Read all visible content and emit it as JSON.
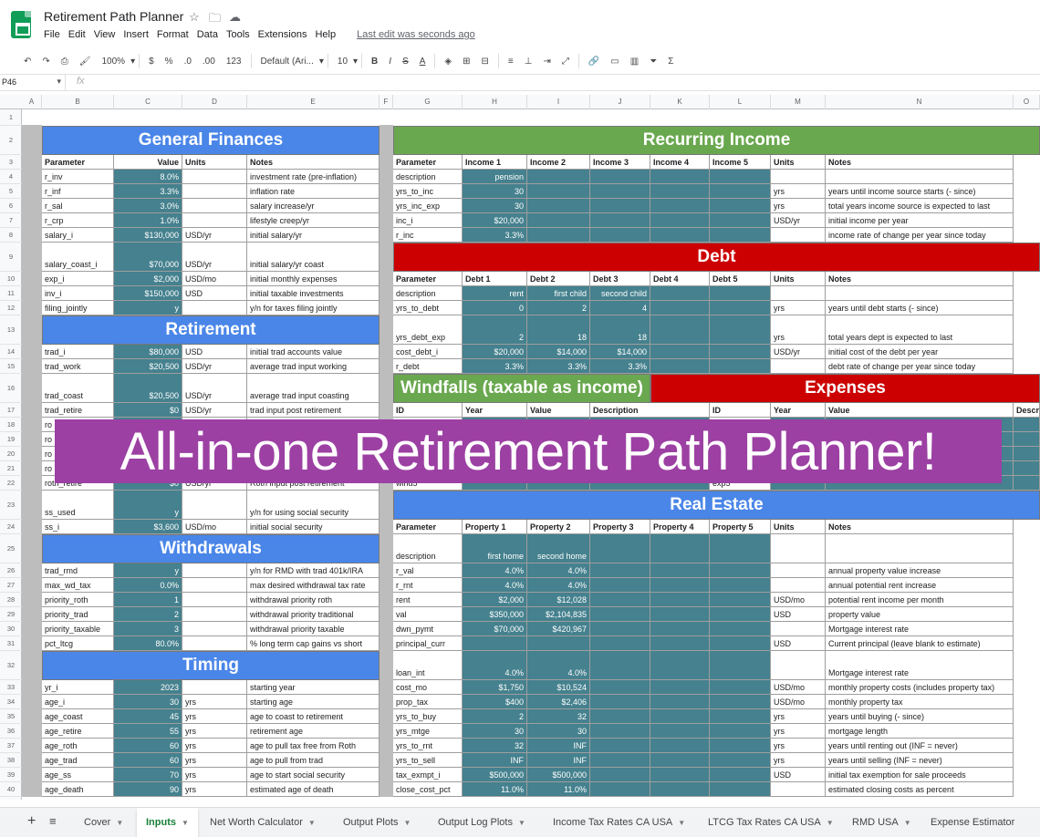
{
  "app": {
    "title": "Retirement Path Planner",
    "last_edit": "Last edit was seconds ago",
    "name_box": "P46",
    "fx": "fx"
  },
  "menu": [
    "File",
    "Edit",
    "View",
    "Insert",
    "Format",
    "Data",
    "Tools",
    "Extensions",
    "Help"
  ],
  "toolbar": {
    "zoom": "100%",
    "currency": "$",
    "percent": "%",
    "dec_less": ".0",
    "dec_more": ".00",
    "format": "123",
    "font": "Default (Ari...",
    "size": "10",
    "bold": "B",
    "italic": "I",
    "strike": "S",
    "text_color": "A",
    "function": "Σ"
  },
  "columns": [
    "A",
    "B",
    "C",
    "D",
    "E",
    "F",
    "G",
    "H",
    "I",
    "J",
    "K",
    "L",
    "M",
    "N",
    "O"
  ],
  "rows": [
    "1",
    "2",
    "3",
    "4",
    "5",
    "6",
    "7",
    "8",
    "9",
    "10",
    "11",
    "12",
    "13",
    "14",
    "15",
    "16",
    "17",
    "18",
    "19",
    "20",
    "21",
    "22",
    "23",
    "24",
    "25",
    "26",
    "27",
    "28",
    "29",
    "30",
    "31",
    "32",
    "33",
    "34",
    "35",
    "36",
    "37",
    "38",
    "39",
    "40"
  ],
  "banner": "All-in-one Retirement Path Planner!",
  "sections": {
    "general": "General Finances",
    "retirement": "Retirement",
    "withdrawals": "Withdrawals",
    "timing": "Timing",
    "recurring": "Recurring Income",
    "debt": "Debt",
    "windfalls": "Windfalls (taxable as income)",
    "expenses": "Expenses",
    "real_estate": "Real Estate"
  },
  "left_header": [
    "Parameter",
    "Value",
    "Units",
    "Notes"
  ],
  "left_rows": [
    {
      "r": 4,
      "p": "r_inv",
      "v": "8.0%",
      "u": "",
      "n": "investment rate (pre-inflation)"
    },
    {
      "r": 5,
      "p": "r_inf",
      "v": "3.3%",
      "u": "",
      "n": "inflation rate"
    },
    {
      "r": 6,
      "p": "r_sal",
      "v": "3.0%",
      "u": "",
      "n": "salary increase/yr"
    },
    {
      "r": 7,
      "p": "r_crp",
      "v": "1.0%",
      "u": "",
      "n": "lifestyle creep/yr"
    },
    {
      "r": 8,
      "p": "salary_i",
      "v": "$130,000",
      "u": "USD/yr",
      "n": "initial salary/yr"
    },
    {
      "r": 9,
      "p": "salary_coast_i",
      "v": "$70,000",
      "u": "USD/yr",
      "n": "initial salary/yr coast"
    },
    {
      "r": 10,
      "p": "exp_i",
      "v": "$2,000",
      "u": "USD/mo",
      "n": "initial monthly expenses"
    },
    {
      "r": 11,
      "p": "inv_i",
      "v": "$150,000",
      "u": "USD",
      "n": "initial taxable investments"
    },
    {
      "r": 12,
      "p": "filing_jointly",
      "v": "y",
      "u": "",
      "n": "y/n for taxes filing jointly"
    },
    {
      "r": 14,
      "p": "trad_i",
      "v": "$80,000",
      "u": "USD",
      "n": "initial trad accounts value"
    },
    {
      "r": 15,
      "p": "trad_work",
      "v": "$20,500",
      "u": "USD/yr",
      "n": "average trad input working"
    },
    {
      "r": 16,
      "p": "trad_coast",
      "v": "$20,500",
      "u": "USD/yr",
      "n": "average trad input coasting"
    },
    {
      "r": 17,
      "p": "trad_retire",
      "v": "$0",
      "u": "USD/yr",
      "n": "trad input post retirement"
    },
    {
      "r": 18,
      "p": "ro",
      "v": "",
      "u": "",
      "n": ""
    },
    {
      "r": 19,
      "p": "ro",
      "v": "",
      "u": "",
      "n": ""
    },
    {
      "r": 20,
      "p": "ro",
      "v": "",
      "u": "",
      "n": ""
    },
    {
      "r": 21,
      "p": "ro",
      "v": "",
      "u": "",
      "n": ""
    },
    {
      "r": 22,
      "p": "roth_retire",
      "v": "$0",
      "u": "USD/yr",
      "n": "Roth input post retirement"
    },
    {
      "r": 23,
      "p": "ss_used",
      "v": "y",
      "u": "",
      "n": "y/n for using social security"
    },
    {
      "r": 24,
      "p": "ss_i",
      "v": "$3,600",
      "u": "USD/mo",
      "n": "initial social security"
    },
    {
      "r": 26,
      "p": "trad_rmd",
      "v": "y",
      "u": "",
      "n": "y/n for RMD with trad 401k/IRA"
    },
    {
      "r": 27,
      "p": "max_wd_tax",
      "v": "0.0%",
      "u": "",
      "n": "max desired withdrawal tax rate"
    },
    {
      "r": 28,
      "p": "priority_roth",
      "v": "1",
      "u": "",
      "n": "withdrawal priority roth"
    },
    {
      "r": 29,
      "p": "priority_trad",
      "v": "2",
      "u": "",
      "n": "withdrawal priority traditional"
    },
    {
      "r": 30,
      "p": "priority_taxable",
      "v": "3",
      "u": "",
      "n": "withdrawal priority taxable"
    },
    {
      "r": 31,
      "p": "pct_ltcg",
      "v": "80.0%",
      "u": "",
      "n": "% long term cap gains vs short"
    },
    {
      "r": 33,
      "p": "yr_i",
      "v": "2023",
      "u": "",
      "n": "starting year"
    },
    {
      "r": 34,
      "p": "age_i",
      "v": "30",
      "u": "yrs",
      "n": "starting age"
    },
    {
      "r": 35,
      "p": "age_coast",
      "v": "45",
      "u": "yrs",
      "n": "age to coast to retirement"
    },
    {
      "r": 36,
      "p": "age_retire",
      "v": "55",
      "u": "yrs",
      "n": "retirement age"
    },
    {
      "r": 37,
      "p": "age_roth",
      "v": "60",
      "u": "yrs",
      "n": "age to pull tax free from Roth"
    },
    {
      "r": 38,
      "p": "age_trad",
      "v": "60",
      "u": "yrs",
      "n": "age to pull from trad"
    },
    {
      "r": 39,
      "p": "age_ss",
      "v": "70",
      "u": "yrs",
      "n": "age to start social security"
    },
    {
      "r": 40,
      "p": "age_death",
      "v": "90",
      "u": "yrs",
      "n": "estimated age of death"
    }
  ],
  "income_header": [
    "Parameter",
    "Income 1",
    "Income 2",
    "Income 3",
    "Income 4",
    "Income 5",
    "Units",
    "Notes"
  ],
  "income_rows": [
    {
      "r": 4,
      "c": [
        "description",
        "pension",
        "",
        "",
        "",
        "",
        "",
        ""
      ]
    },
    {
      "r": 5,
      "c": [
        "yrs_to_inc",
        "30",
        "",
        "",
        "",
        "",
        "yrs",
        "years until income source starts (- since)"
      ]
    },
    {
      "r": 6,
      "c": [
        "yrs_inc_exp",
        "30",
        "",
        "",
        "",
        "",
        "yrs",
        "total years income source is expected to last"
      ]
    },
    {
      "r": 7,
      "c": [
        "inc_i",
        "$20,000",
        "",
        "",
        "",
        "",
        "USD/yr",
        "initial income per year"
      ]
    },
    {
      "r": 8,
      "c": [
        "r_inc",
        "3.3%",
        "",
        "",
        "",
        "",
        "",
        "income rate of change per year since today"
      ]
    }
  ],
  "debt_header": [
    "Parameter",
    "Debt 1",
    "Debt 2",
    "Debt 3",
    "Debt 4",
    "Debt 5",
    "Units",
    "Notes"
  ],
  "debt_rows": [
    {
      "r": 11,
      "c": [
        "description",
        "rent",
        "first child",
        "second child",
        "",
        "",
        "",
        ""
      ]
    },
    {
      "r": 12,
      "c": [
        "yrs_to_debt",
        "0",
        "2",
        "4",
        "",
        "",
        "yrs",
        "years until debt starts (- since)"
      ]
    },
    {
      "r": 13,
      "c": [
        "yrs_debt_exp",
        "2",
        "18",
        "18",
        "",
        "",
        "yrs",
        "total years dept is expected to last"
      ]
    },
    {
      "r": 14,
      "c": [
        "cost_debt_i",
        "$20,000",
        "$14,000",
        "$14,000",
        "",
        "",
        "USD/yr",
        "initial cost of the debt per year"
      ]
    },
    {
      "r": 15,
      "c": [
        "r_debt",
        "3.3%",
        "3.3%",
        "3.3%",
        "",
        "",
        "",
        "debt rate of change per year since today"
      ]
    }
  ],
  "windfall_header": [
    "ID",
    "Year",
    "Value",
    "Description"
  ],
  "expense_header": [
    "ID",
    "Year",
    "Value",
    "Description"
  ],
  "windfall_last": "wind5",
  "expense_last": "exp5",
  "re_header": [
    "Parameter",
    "Property 1",
    "Property 2",
    "Property 3",
    "Property 4",
    "Property 5",
    "Units",
    "Notes"
  ],
  "re_rows": [
    {
      "r": 25,
      "c": [
        "description",
        "first home",
        "second home",
        "",
        "",
        "",
        "",
        ""
      ]
    },
    {
      "r": 26,
      "c": [
        "r_val",
        "4.0%",
        "4.0%",
        "",
        "",
        "",
        "",
        "annual property value increase"
      ]
    },
    {
      "r": 27,
      "c": [
        "r_rnt",
        "4.0%",
        "4.0%",
        "",
        "",
        "",
        "",
        "annual potential rent increase"
      ]
    },
    {
      "r": 28,
      "c": [
        "rent",
        "$2,000",
        "$12,028",
        "",
        "",
        "",
        "USD/mo",
        "potential rent income per month"
      ]
    },
    {
      "r": 29,
      "c": [
        "val",
        "$350,000",
        "$2,104,835",
        "",
        "",
        "",
        "USD",
        "property value"
      ]
    },
    {
      "r": 30,
      "c": [
        "dwn_pymt",
        "$70,000",
        "$420,967",
        "",
        "",
        "",
        "",
        "Mortgage interest rate"
      ]
    },
    {
      "r": 31,
      "c": [
        "principal_curr",
        "",
        "",
        "",
        "",
        "",
        "USD",
        "Current principal (leave blank to estimate)"
      ]
    },
    {
      "r": 32,
      "c": [
        "loan_int",
        "4.0%",
        "4.0%",
        "",
        "",
        "",
        "",
        "Mortgage interest rate"
      ]
    },
    {
      "r": 33,
      "c": [
        "cost_mo",
        "$1,750",
        "$10,524",
        "",
        "",
        "",
        "USD/mo",
        "monthly property costs (includes property tax)"
      ]
    },
    {
      "r": 34,
      "c": [
        "prop_tax",
        "$400",
        "$2,406",
        "",
        "",
        "",
        "USD/mo",
        "monthly property tax"
      ]
    },
    {
      "r": 35,
      "c": [
        "yrs_to_buy",
        "2",
        "32",
        "",
        "",
        "",
        "yrs",
        "years until buying (- since)"
      ]
    },
    {
      "r": 36,
      "c": [
        "yrs_mtge",
        "30",
        "30",
        "",
        "",
        "",
        "yrs",
        "mortgage length"
      ]
    },
    {
      "r": 37,
      "c": [
        "yrs_to_rnt",
        "32",
        "INF",
        "",
        "",
        "",
        "yrs",
        "years until renting out (INF = never)"
      ]
    },
    {
      "r": 38,
      "c": [
        "yrs_to_sell",
        "INF",
        "INF",
        "",
        "",
        "",
        "yrs",
        "years until selling (INF = never)"
      ]
    },
    {
      "r": 39,
      "c": [
        "tax_exmpt_i",
        "$500,000",
        "$500,000",
        "",
        "",
        "",
        "USD",
        "initial tax exemption for sale proceeds"
      ]
    },
    {
      "r": 40,
      "c": [
        "close_cost_pct",
        "11.0%",
        "11.0%",
        "",
        "",
        "",
        "",
        "estimated closing costs as percent"
      ]
    }
  ],
  "tabs": [
    "Cover",
    "Inputs",
    "Net Worth Calculator",
    "Output Plots",
    "Output Log Plots",
    "Income Tax Rates CA USA",
    "LTCG Tax Rates CA USA",
    "RMD USA",
    "Expense Estimator"
  ],
  "colors": {
    "blue": "#4a86e8",
    "green": "#6aa84f",
    "red": "#cc0000",
    "teal": "#45818e",
    "purple": "#9c40a3"
  }
}
